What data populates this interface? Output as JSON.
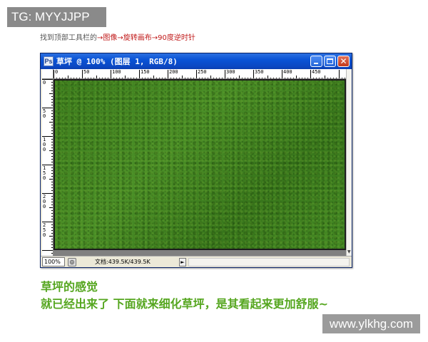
{
  "badge": {
    "text": "TG: MYYJJPP"
  },
  "instruction": {
    "prefix": "找到顶部工具栏的",
    "arrow1": "→",
    "step1": "图像",
    "arrow2": "→",
    "step2": "旋转画布",
    "arrow3": "→",
    "step3": "90度逆时针"
  },
  "window": {
    "title": "草坪 @ 100% (图层 1, RGB/8)",
    "app_icon": "Ps",
    "minimize_icon": "minimize-icon",
    "maximize_icon": "maximize-icon",
    "close_icon": "close-icon",
    "close_glyph": "✕"
  },
  "ruler": {
    "top_labels": [
      "0",
      "50",
      "100",
      "150",
      "200",
      "250",
      "300",
      "350",
      "400",
      "450"
    ],
    "left_labels": [
      "0",
      "50",
      "100",
      "150",
      "200",
      "250"
    ]
  },
  "canvas": {
    "fill_color": "#3f8120",
    "texture": "grass"
  },
  "statusbar": {
    "zoom": "100%",
    "doc_info": "文档:439.5K/439.5K",
    "arrow": "►"
  },
  "caption": {
    "line1": "草坪的感觉",
    "line2": "就已经出来了 下面就来细化草坪，是其看起来更加舒服~"
  },
  "watermark": {
    "text": "www.ylkhg.com"
  },
  "colors": {
    "caption_green": "#55a61f",
    "instruction_red": "#c01818",
    "titlebar_blue": "#0a53d6",
    "badge_gray": "#8a8a8a"
  }
}
